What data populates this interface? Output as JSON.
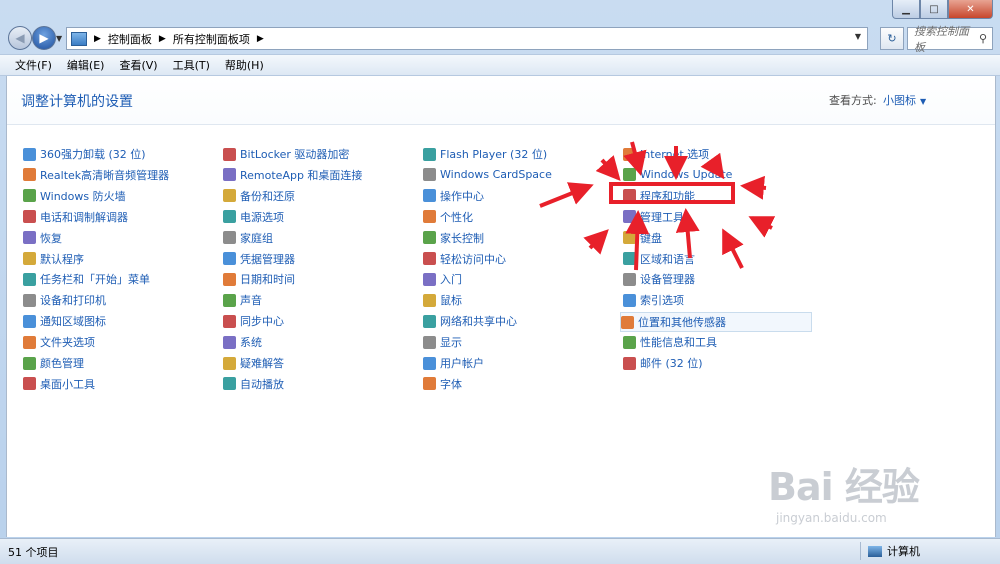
{
  "window": {
    "title": "控制面板"
  },
  "nav": {
    "breadcrumb": [
      "控制面板",
      "所有控制面板项"
    ],
    "search_placeholder": "搜索控制面板"
  },
  "menu": [
    "文件(F)",
    "编辑(E)",
    "查看(V)",
    "工具(T)",
    "帮助(H)"
  ],
  "header": {
    "title": "调整计算机的设置",
    "view_label": "查看方式:",
    "view_value": "小图标"
  },
  "items": {
    "col1": [
      "360强力卸载 (32 位)",
      "Realtek高清晰音频管理器",
      "Windows 防火墙",
      "电话和调制解调器",
      "恢复",
      "默认程序",
      "任务栏和「开始」菜单",
      "设备和打印机",
      "通知区域图标",
      "文件夹选项",
      "颜色管理",
      "桌面小工具"
    ],
    "col2": [
      "BitLocker 驱动器加密",
      "RemoteApp 和桌面连接",
      "备份和还原",
      "电源选项",
      "家庭组",
      "凭据管理器",
      "日期和时间",
      "声音",
      "同步中心",
      "系统",
      "疑难解答",
      "自动播放"
    ],
    "col3": [
      "Flash Player (32 位)",
      "Windows CardSpace",
      "操作中心",
      "个性化",
      "家长控制",
      "轻松访问中心",
      "入门",
      "鼠标",
      "网络和共享中心",
      "显示",
      "用户帐户",
      "字体"
    ],
    "col4": [
      "Internet 选项",
      "Windows Update",
      "程序和功能",
      "管理工具",
      "键盘",
      "区域和语言",
      "设备管理器",
      "索引选项",
      "位置和其他传感器",
      "性能信息和工具",
      "邮件 (32 位)"
    ]
  },
  "status": {
    "count": "51 个项目",
    "computer": "计算机"
  },
  "watermark": {
    "logo": "Bai 经验",
    "url": "jingyan.baidu.com"
  },
  "colors": {
    "link": "#1e5db4",
    "highlight": "#e8202a",
    "frame": "#b9d1ec"
  }
}
